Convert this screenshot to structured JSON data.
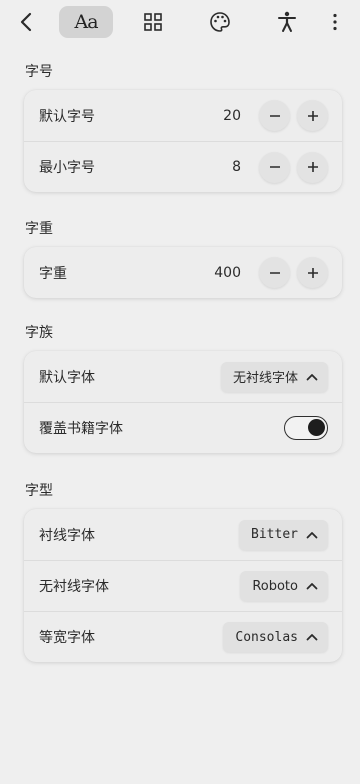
{
  "toolbar": {
    "items": [
      {
        "icon": "back-arrow-icon"
      },
      {
        "icon": "font-size-icon",
        "label": "Aa",
        "active": true
      },
      {
        "icon": "layout-grid-icon"
      },
      {
        "icon": "palette-icon"
      },
      {
        "icon": "accessibility-icon"
      },
      {
        "icon": "more-vertical-icon"
      }
    ]
  },
  "font_size": {
    "title": "字号",
    "default_label": "默认字号",
    "default_value": "20",
    "min_label": "最小字号",
    "min_value": "8"
  },
  "font_weight": {
    "title": "字重",
    "label": "字重",
    "value": "400"
  },
  "font_family": {
    "title": "字族",
    "default_label": "默认字体",
    "default_value": "无衬线字体",
    "override_label": "覆盖书籍字体",
    "override_on": true
  },
  "typeface": {
    "title": "字型",
    "serif_label": "衬线字体",
    "serif_value": "Bitter",
    "sans_label": "无衬线字体",
    "sans_value": "Roboto",
    "mono_label": "等宽字体",
    "mono_value": "Consolas"
  },
  "colors": {
    "background": "#efefef",
    "card": "#ededed",
    "active_tab": "#d3d3d3",
    "text": "#2b2b2b"
  }
}
